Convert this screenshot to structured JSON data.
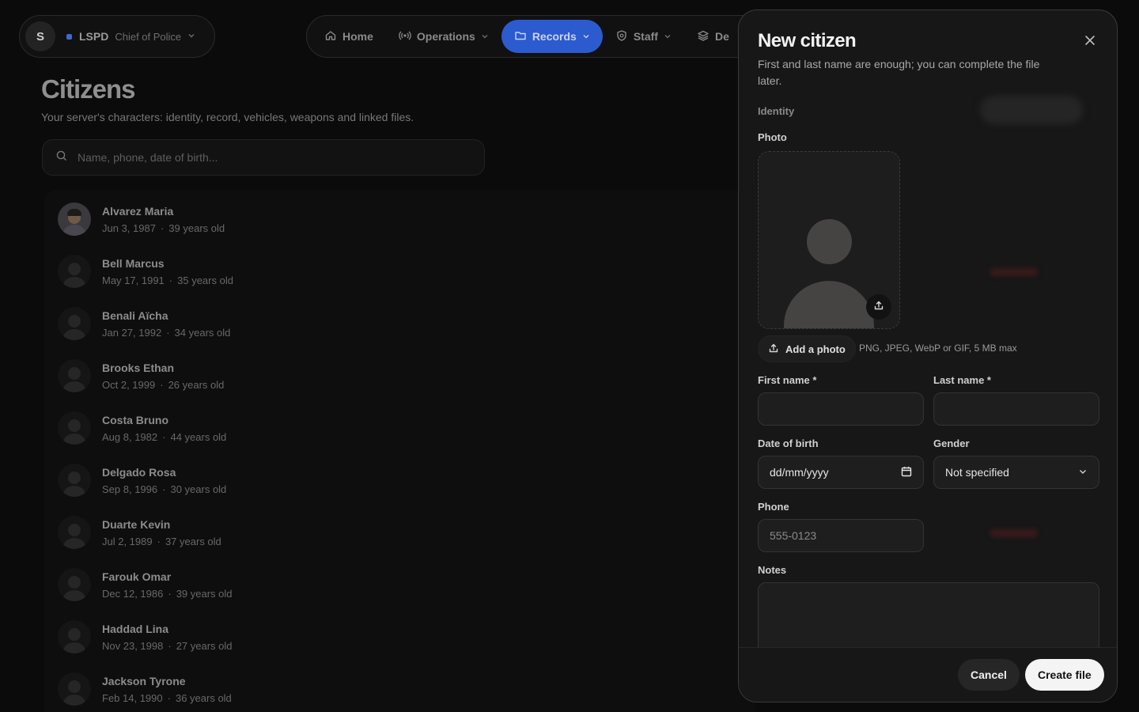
{
  "org": {
    "avatar_letter": "S",
    "name": "LSPD",
    "role": "Chief of Police",
    "accent_color": "#3f66d8"
  },
  "nav": {
    "items": [
      {
        "label": "Home",
        "icon": "home-icon"
      },
      {
        "label": "Operations",
        "icon": "radio-icon"
      },
      {
        "label": "Records",
        "icon": "folder-icon",
        "active": true
      },
      {
        "label": "Staff",
        "icon": "shield-icon"
      },
      {
        "label": "De",
        "icon": "layers-icon"
      }
    ],
    "active_color": "#2c5bd0"
  },
  "page": {
    "title": "Citizens",
    "subtitle": "Your server's characters: identity, record, vehicles, weapons and linked files.",
    "search_placeholder": "Name, phone, date of birth..."
  },
  "citizens": [
    {
      "name": "Alvarez Maria",
      "dob": "Jun 3, 1987",
      "age": "39 years old",
      "has_photo": true
    },
    {
      "name": "Bell Marcus",
      "dob": "May 17, 1991",
      "age": "35 years old"
    },
    {
      "name": "Benali Aïcha",
      "dob": "Jan 27, 1992",
      "age": "34 years old"
    },
    {
      "name": "Brooks Ethan",
      "dob": "Oct 2, 1999",
      "age": "26 years old"
    },
    {
      "name": "Costa Bruno",
      "dob": "Aug 8, 1982",
      "age": "44 years old"
    },
    {
      "name": "Delgado Rosa",
      "dob": "Sep 8, 1996",
      "age": "30 years old"
    },
    {
      "name": "Duarte Kevin",
      "dob": "Jul 2, 1989",
      "age": "37 years old"
    },
    {
      "name": "Farouk Omar",
      "dob": "Dec 12, 1986",
      "age": "39 years old"
    },
    {
      "name": "Haddad Lina",
      "dob": "Nov 23, 1998",
      "age": "27 years old"
    },
    {
      "name": "Jackson Tyrone",
      "dob": "Feb 14, 1990",
      "age": "36 years old"
    }
  ],
  "modal": {
    "title": "New citizen",
    "subtitle": "First and last name are enough; you can complete the file later.",
    "section": "Identity",
    "photo_label": "Photo",
    "add_photo": "Add a photo",
    "photo_hint": "PNG, JPEG, WebP or GIF, 5 MB max",
    "first_name_label": "First name *",
    "last_name_label": "Last name *",
    "dob_label": "Date of birth",
    "dob_placeholder": "dd/mm/yyyy",
    "gender_label": "Gender",
    "gender_value": "Not specified",
    "phone_label": "Phone",
    "phone_placeholder": "555-0123",
    "notes_label": "Notes",
    "cancel": "Cancel",
    "create": "Create file"
  }
}
